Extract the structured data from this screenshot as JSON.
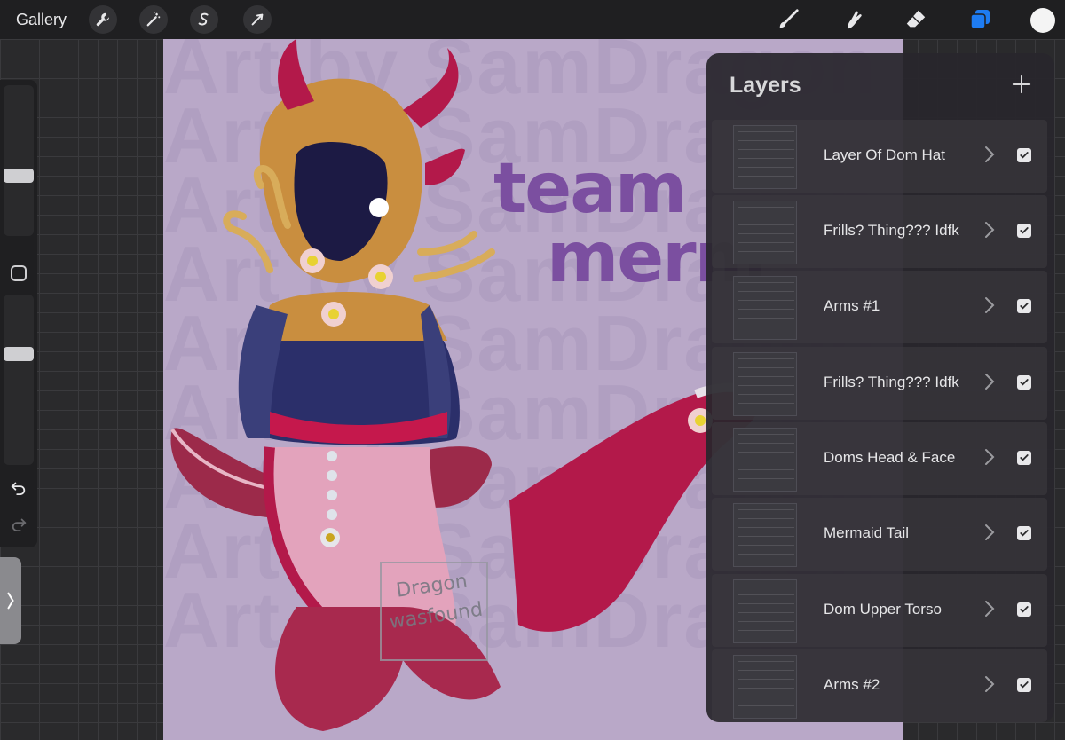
{
  "topbar": {
    "gallery_label": "Gallery",
    "left_tools": [
      "wrench-icon",
      "magic-wand-icon",
      "selection-icon",
      "transform-icon"
    ],
    "right_tools": [
      "brush-icon",
      "smudge-icon",
      "eraser-icon",
      "layers-icon"
    ],
    "accent_color": "#1e7cf2",
    "current_color": "#f4f4f4"
  },
  "sidebar": {
    "size_level": 0.4,
    "opacity_level": 0.65
  },
  "canvas": {
    "watermark_lines": [
      "Art by SamDragon",
      "Art by SamDragon",
      "Art by SamDragon",
      "Art by SamDragon",
      "Art by SamDragon",
      "Art by SamDragon",
      "Art by SamDragon",
      "Art by SamDragon",
      "Art by SamDragon"
    ],
    "overlay_text_1": "team",
    "overlay_text_2": "merm",
    "signature": "Dragon wasfound"
  },
  "layers_panel": {
    "title": "Layers",
    "layers": [
      {
        "name": "Layer Of Dom Hat",
        "visible": true
      },
      {
        "name": "Frills? Thing??? Idfk",
        "visible": true
      },
      {
        "name": "Arms #1",
        "visible": true
      },
      {
        "name": "Frills? Thing??? Idfk",
        "visible": true
      },
      {
        "name": "Doms Head & Face",
        "visible": true
      },
      {
        "name": "Mermaid Tail",
        "visible": true
      },
      {
        "name": "Dom Upper Torso",
        "visible": true
      },
      {
        "name": "Arms #2",
        "visible": true
      }
    ]
  }
}
